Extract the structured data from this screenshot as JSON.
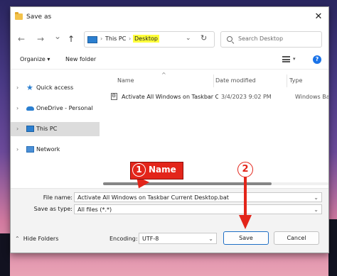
{
  "window": {
    "title": "Save as",
    "close_label": "✕"
  },
  "navbar": {
    "back": "←",
    "forward": "→",
    "recent": "⌄",
    "up": "↑",
    "breadcrumb": [
      "This PC",
      "Desktop"
    ],
    "breadcrumb_sep": "›",
    "address_dropdown": "⌄",
    "refresh": "↻",
    "search_placeholder": "Search Desktop"
  },
  "toolbar": {
    "organize": "Organize ▾",
    "new_folder": "New folder",
    "view_chevron": "▾",
    "help": "?"
  },
  "sidebar": {
    "items": [
      {
        "label": "Quick access",
        "icon": "star-icon"
      },
      {
        "label": "OneDrive - Personal",
        "icon": "cloud-icon"
      },
      {
        "label": "This PC",
        "icon": "monitor-icon",
        "selected": true
      },
      {
        "label": "Network",
        "icon": "network-icon"
      }
    ]
  },
  "columns": {
    "name": "Name",
    "date": "Date modified",
    "type": "Type",
    "sort_arrow": "^"
  },
  "files": [
    {
      "name": "Activate All Windows on Taskbar Current Desktop.bat",
      "date": "3/4/2023 9:02 PM",
      "type": "Windows Batch File"
    }
  ],
  "form": {
    "filename_label": "File name:",
    "filename_value": "Activate All Windows on Taskbar Current Desktop.bat",
    "savetype_label": "Save as type:",
    "savetype_value": "All files  (*.*)"
  },
  "bottom": {
    "hide_folders": "Hide Folders",
    "encoding_label": "Encoding:",
    "encoding_value": "UTF-8",
    "save": "Save",
    "cancel": "Cancel"
  },
  "annotations": {
    "step1_num": "1",
    "step1_label": "Name",
    "step2_num": "2"
  },
  "colors": {
    "annotation": "#e3251a",
    "highlight": "#ffff3b",
    "accent": "#1a73e8"
  }
}
